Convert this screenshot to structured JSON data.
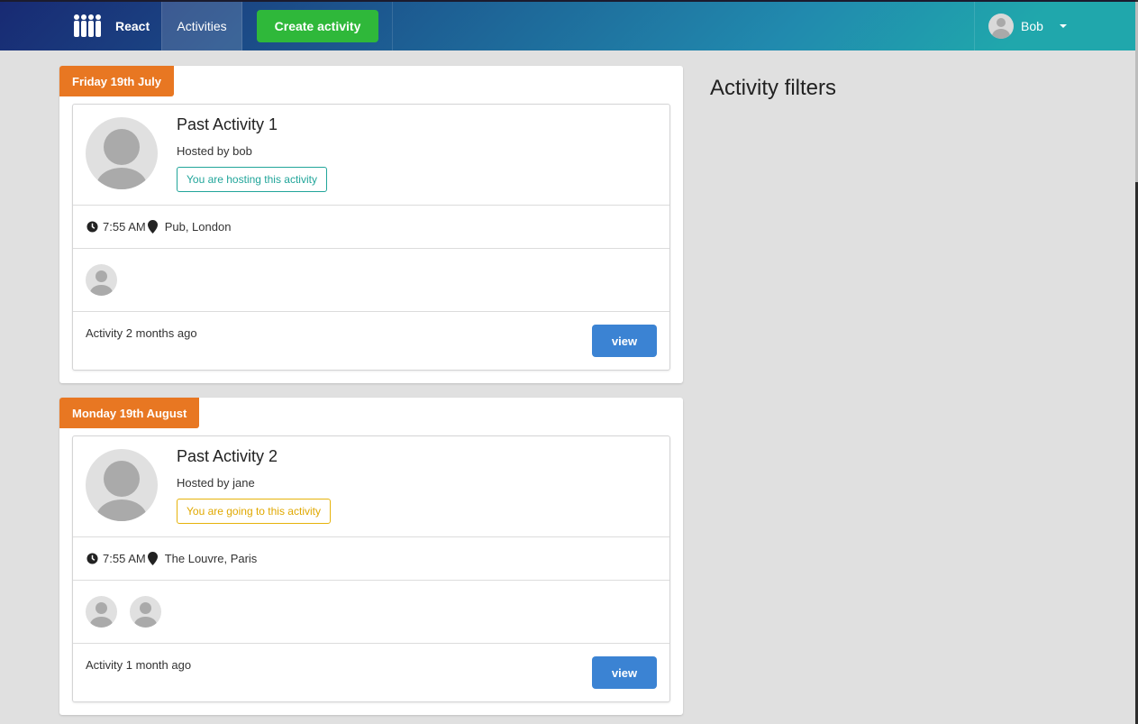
{
  "nav": {
    "brand": "React",
    "activities": "Activities",
    "create": "Create activity",
    "user": "Bob"
  },
  "groups": [
    {
      "date": "Friday 19th July",
      "activity": {
        "title": "Past Activity 1",
        "hosted": "Hosted by bob",
        "badge": "You are hosting this activity",
        "time": "7:55 AM",
        "location": "Pub, London",
        "footer": "Activity 2 months ago",
        "view": "view",
        "attendees": 1
      }
    },
    {
      "date": "Monday 19th August",
      "activity": {
        "title": "Past Activity 2",
        "hosted": "Hosted by jane",
        "badge": "You are going to this activity",
        "time": "7:55 AM",
        "location": "The Louvre, Paris",
        "footer": "Activity 1 month ago",
        "view": "view",
        "attendees": 2
      }
    }
  ],
  "filters": {
    "title": "Activity filters"
  },
  "colors": {
    "date_label": "#e87722",
    "create_button": "#2fb83a",
    "view_button": "#3b83d3",
    "hosting_badge": "#21a59a",
    "going_badge": "#e6b30b"
  }
}
